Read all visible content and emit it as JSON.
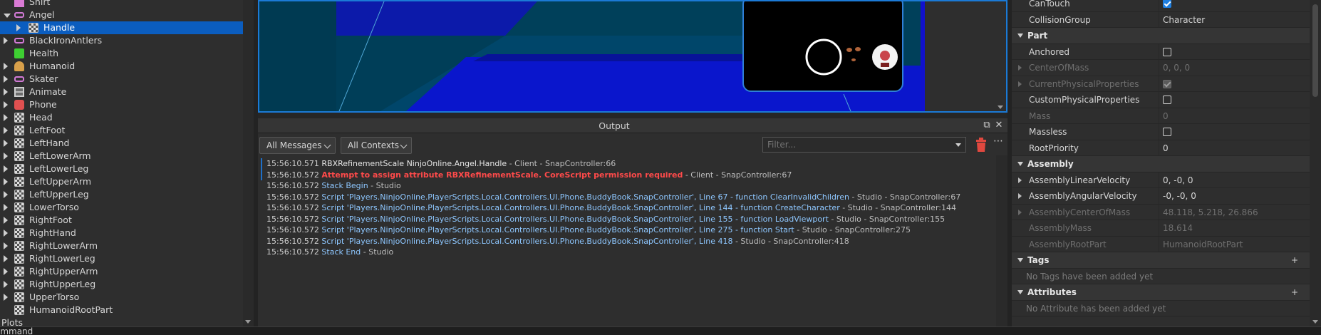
{
  "explorer": {
    "items": [
      {
        "label": "Shirt",
        "icon": "shirt-icon",
        "level": 1,
        "expandable": false,
        "selected": false
      },
      {
        "label": "Angel",
        "icon": "accessory-icon",
        "level": 1,
        "expandable": true,
        "expanded": true,
        "selected": false
      },
      {
        "label": "Handle",
        "icon": "part-icon",
        "level": 2,
        "expandable": true,
        "selected": true
      },
      {
        "label": "BlackIronAntlers",
        "icon": "accessory-icon",
        "level": 1,
        "expandable": true,
        "selected": false
      },
      {
        "label": "Health",
        "icon": "script-icon",
        "level": 1,
        "expandable": false,
        "selected": false
      },
      {
        "label": "Humanoid",
        "icon": "humanoid-icon",
        "level": 1,
        "expandable": true,
        "selected": false
      },
      {
        "label": "Skater",
        "icon": "accessory-icon",
        "level": 1,
        "expandable": true,
        "selected": false
      },
      {
        "label": "Animate",
        "icon": "local-script-icon",
        "level": 1,
        "expandable": true,
        "selected": false
      },
      {
        "label": "Phone",
        "icon": "tool-icon",
        "level": 1,
        "expandable": true,
        "selected": false
      },
      {
        "label": "Head",
        "icon": "part-icon",
        "level": 1,
        "expandable": true,
        "selected": false
      },
      {
        "label": "LeftFoot",
        "icon": "part-icon",
        "level": 1,
        "expandable": true,
        "selected": false
      },
      {
        "label": "LeftHand",
        "icon": "part-icon",
        "level": 1,
        "expandable": true,
        "selected": false
      },
      {
        "label": "LeftLowerArm",
        "icon": "part-icon",
        "level": 1,
        "expandable": true,
        "selected": false
      },
      {
        "label": "LeftLowerLeg",
        "icon": "part-icon",
        "level": 1,
        "expandable": true,
        "selected": false
      },
      {
        "label": "LeftUpperArm",
        "icon": "part-icon",
        "level": 1,
        "expandable": true,
        "selected": false
      },
      {
        "label": "LeftUpperLeg",
        "icon": "part-icon",
        "level": 1,
        "expandable": true,
        "selected": false
      },
      {
        "label": "LowerTorso",
        "icon": "part-icon",
        "level": 1,
        "expandable": true,
        "selected": false
      },
      {
        "label": "RightFoot",
        "icon": "part-icon",
        "level": 1,
        "expandable": true,
        "selected": false
      },
      {
        "label": "RightHand",
        "icon": "part-icon",
        "level": 1,
        "expandable": true,
        "selected": false
      },
      {
        "label": "RightLowerArm",
        "icon": "part-icon",
        "level": 1,
        "expandable": true,
        "selected": false
      },
      {
        "label": "RightLowerLeg",
        "icon": "part-icon",
        "level": 1,
        "expandable": true,
        "selected": false
      },
      {
        "label": "RightUpperArm",
        "icon": "part-icon",
        "level": 1,
        "expandable": true,
        "selected": false
      },
      {
        "label": "RightUpperLeg",
        "icon": "part-icon",
        "level": 1,
        "expandable": true,
        "selected": false
      },
      {
        "label": "UpperTorso",
        "icon": "part-icon",
        "level": 1,
        "expandable": true,
        "selected": false
      },
      {
        "label": "HumanoidRootPart",
        "icon": "part-icon",
        "level": 1,
        "expandable": false,
        "selected": false
      },
      {
        "label": "Plots",
        "icon": "",
        "level": 0,
        "expandable": false,
        "selected": false
      }
    ]
  },
  "output": {
    "title": "Output",
    "message_filter": "All Messages",
    "context_filter": "All Contexts",
    "filter_placeholder": "Filter...",
    "lines": [
      {
        "time": "15:56:10.571",
        "text": "RBXRefinementScale NinjoOnline.Angel.Handle",
        "kind": "normal",
        "source": " - Client - SnapController:66",
        "marked": true
      },
      {
        "time": "15:56:10.572",
        "text": "Attempt to assign attribute RBXRefinementScale. CoreScript permission required",
        "kind": "error",
        "source": " - Client - SnapController:67",
        "marked": true
      },
      {
        "time": "15:56:10.572",
        "text": "Stack Begin",
        "kind": "link",
        "source": " - Studio",
        "marked": false
      },
      {
        "time": "15:56:10.572",
        "text": "Script 'Players.NinjoOnline.PlayerScripts.Local.Controllers.UI.Phone.BuddyBook.SnapController', Line 67 - function ClearInvalidChildren",
        "kind": "link",
        "source": " - Studio - SnapController:67",
        "marked": false
      },
      {
        "time": "15:56:10.572",
        "text": "Script 'Players.NinjoOnline.PlayerScripts.Local.Controllers.UI.Phone.BuddyBook.SnapController', Line 144 - function CreateCharacter",
        "kind": "link",
        "source": " - Studio - SnapController:144",
        "marked": false
      },
      {
        "time": "15:56:10.572",
        "text": "Script 'Players.NinjoOnline.PlayerScripts.Local.Controllers.UI.Phone.BuddyBook.SnapController', Line 155 - function LoadViewport",
        "kind": "link",
        "source": " - Studio - SnapController:155",
        "marked": false
      },
      {
        "time": "15:56:10.572",
        "text": "Script 'Players.NinjoOnline.PlayerScripts.Local.Controllers.UI.Phone.BuddyBook.SnapController', Line 275 - function Start",
        "kind": "link",
        "source": " - Studio - SnapController:275",
        "marked": false
      },
      {
        "time": "15:56:10.572",
        "text": "Script 'Players.NinjoOnline.PlayerScripts.Local.Controllers.UI.Phone.BuddyBook.SnapController', Line 418",
        "kind": "link",
        "source": " - Studio - SnapController:418",
        "marked": false
      },
      {
        "time": "15:56:10.572",
        "text": "Stack End",
        "kind": "link",
        "source": " - Studio",
        "marked": false
      }
    ]
  },
  "properties": {
    "rows": [
      {
        "type": "prop",
        "name": "CanTouch",
        "checkbox": true,
        "checked": true
      },
      {
        "type": "prop",
        "name": "CollisionGroup",
        "value": "Character"
      },
      {
        "type": "category",
        "name": "Part"
      },
      {
        "type": "prop",
        "name": "Anchored",
        "checkbox": true,
        "checked": false
      },
      {
        "type": "prop",
        "name": "CenterOfMass",
        "value": "0, 0, 0",
        "dim": true,
        "expand": true
      },
      {
        "type": "prop",
        "name": "CurrentPhysicalProperties",
        "checkbox": true,
        "checked": true,
        "dim": true,
        "expand": true
      },
      {
        "type": "prop",
        "name": "CustomPhysicalProperties",
        "checkbox": true,
        "checked": false
      },
      {
        "type": "prop",
        "name": "Mass",
        "value": "0",
        "dim": true
      },
      {
        "type": "prop",
        "name": "Massless",
        "checkbox": true,
        "checked": false
      },
      {
        "type": "prop",
        "name": "RootPriority",
        "value": "0"
      },
      {
        "type": "category",
        "name": "Assembly"
      },
      {
        "type": "prop",
        "name": "AssemblyLinearVelocity",
        "value": "0, -0, 0",
        "expand": true
      },
      {
        "type": "prop",
        "name": "AssemblyAngularVelocity",
        "value": "-0, -0, 0",
        "expand": true
      },
      {
        "type": "prop",
        "name": "AssemblyCenterOfMass",
        "value": "48.118, 5.218, 26.866",
        "dim": true,
        "expand": true
      },
      {
        "type": "prop",
        "name": "AssemblyMass",
        "value": "18.614",
        "dim": true
      },
      {
        "type": "prop",
        "name": "AssemblyRootPart",
        "value": "HumanoidRootPart",
        "dim": true
      },
      {
        "type": "category",
        "name": "Tags",
        "plus": true
      },
      {
        "type": "note",
        "text": "No Tags have been added yet"
      },
      {
        "type": "category",
        "name": "Attributes",
        "plus": true
      },
      {
        "type": "note",
        "text": "No Attribute has been added yet"
      }
    ]
  },
  "command": {
    "label": "ommand"
  },
  "colors": {
    "selection": "#0b5dbf",
    "error": "#ff4a4a",
    "link": "#8ec7ff",
    "viewport_blue": "#0a1ad6",
    "checkbox_on": "#1f7fe0"
  }
}
